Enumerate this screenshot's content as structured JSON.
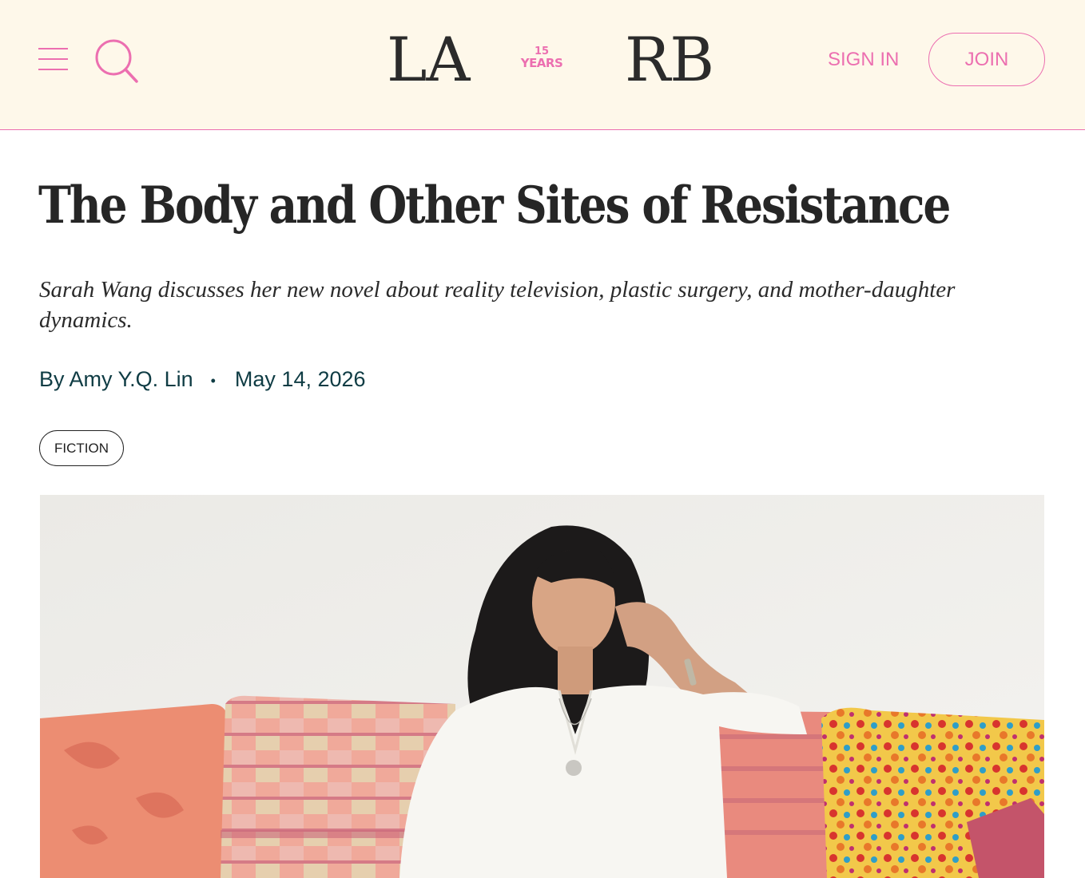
{
  "header": {
    "logo": {
      "left": "LA",
      "years_number": "15",
      "years_word": "YEARS",
      "right": "RB"
    },
    "sign_in_label": "SIGN IN",
    "join_label": "JOIN",
    "menu_icon": "hamburger-menu-icon",
    "search_icon": "search-icon"
  },
  "article": {
    "title": "The Body and Other Sites of Resistance",
    "subtitle": "Sarah Wang discusses her new novel about reality television, plastic surgery, and mother-daughter dynamics.",
    "author": "By Amy Y.Q. Lin",
    "separator": "•",
    "date": "May 14, 2026",
    "tag": "FICTION"
  },
  "colors": {
    "accent": "#ec6fb0",
    "header_bg": "#fef8ea",
    "byline": "#0f3c44",
    "text": "#262626"
  }
}
